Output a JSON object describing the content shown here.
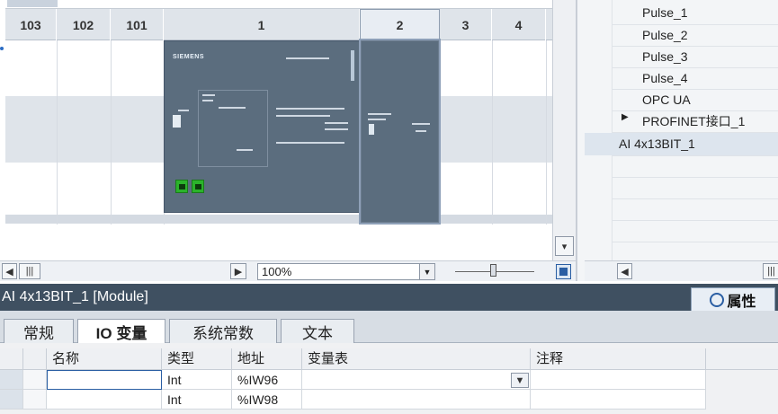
{
  "device_view": {
    "slots": [
      {
        "label": "103"
      },
      {
        "label": "102"
      },
      {
        "label": "101"
      },
      {
        "label": "1"
      },
      {
        "label": "2"
      },
      {
        "label": "3"
      },
      {
        "label": "4"
      }
    ],
    "cpu_brand": "SIEMENS",
    "zoom_value": "100%"
  },
  "right_panel": {
    "items": [
      "Pulse_1",
      "Pulse_2",
      "Pulse_3",
      "Pulse_4",
      "OPC UA",
      "PROFINET接口_1",
      "AI 4x13BIT_1"
    ]
  },
  "module_title": "AI 4x13BIT_1 [Module]",
  "properties_label": "属性",
  "tabs": [
    "常规",
    "IO 变量",
    "系统常数",
    "文本"
  ],
  "table": {
    "headers": [
      "名称",
      "类型",
      "地址",
      "变量表",
      "注释"
    ],
    "rows": [
      {
        "name": "",
        "type": "Int",
        "address": "%IW96",
        "table": "",
        "comment": ""
      },
      {
        "name": "",
        "type": "Int",
        "address": "%IW98",
        "table": "",
        "comment": ""
      }
    ]
  }
}
